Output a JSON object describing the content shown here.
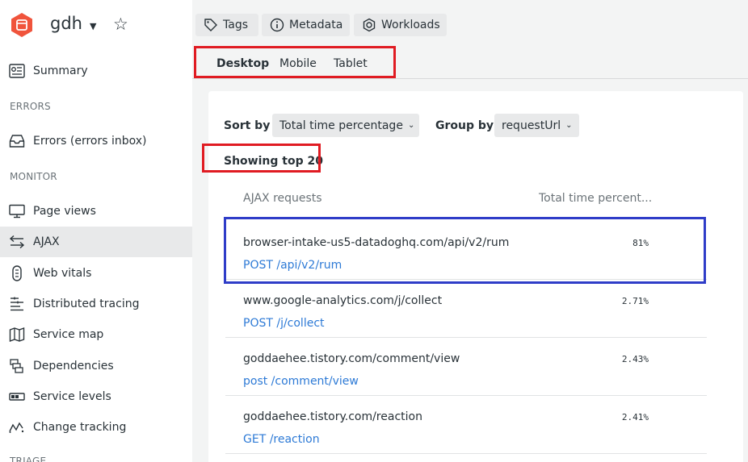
{
  "app": {
    "name": "gdh",
    "icon": "app-hex-icon"
  },
  "top_buttons": [
    {
      "label": "Tags",
      "icon": "tag-icon"
    },
    {
      "label": "Metadata",
      "icon": "info-icon"
    },
    {
      "label": "Workloads",
      "icon": "workloads-icon"
    }
  ],
  "sidebar": {
    "summary": {
      "label": "Summary",
      "icon": "summary-icon"
    },
    "section_errors": "ERRORS",
    "errors_inbox": {
      "label": "Errors (errors inbox)",
      "icon": "inbox-icon"
    },
    "section_monitor": "MONITOR",
    "items": [
      {
        "label": "Page views",
        "icon": "monitor-icon"
      },
      {
        "label": "AJAX",
        "icon": "ajax-arrows-icon",
        "active": true
      },
      {
        "label": "Web vitals",
        "icon": "web-vitals-icon"
      },
      {
        "label": "Distributed tracing",
        "icon": "tracing-icon"
      },
      {
        "label": "Service map",
        "icon": "map-icon"
      },
      {
        "label": "Dependencies",
        "icon": "dependencies-icon"
      },
      {
        "label": "Service levels",
        "icon": "service-levels-icon"
      },
      {
        "label": "Change tracking",
        "icon": "change-tracking-icon"
      }
    ],
    "section_triage": "TRIAGE"
  },
  "tabs": [
    {
      "label": "Desktop",
      "active": true
    },
    {
      "label": "Mobile",
      "active": false
    },
    {
      "label": "Tablet",
      "active": false
    }
  ],
  "controls": {
    "sort_label": "Sort by",
    "sort_value": "Total time percentage",
    "group_label": "Group by",
    "group_value": "requestUrl"
  },
  "showing": "Showing top 20",
  "table": {
    "col_requests": "AJAX requests",
    "col_percent": "Total time percent...",
    "rows": [
      {
        "host": "browser-intake-us5-datadoghq.com/api/v2/rum",
        "path": "POST /api/v2/rum",
        "percent": "81%"
      },
      {
        "host": "www.google-analytics.com/j/collect",
        "path": "POST /j/collect",
        "percent": "2.71%"
      },
      {
        "host": "goddaehee.tistory.com/comment/view",
        "path": "post /comment/view",
        "percent": "2.43%"
      },
      {
        "host": "goddaehee.tistory.com/reaction",
        "path": "GET /reaction",
        "percent": "2.41%"
      }
    ]
  },
  "colors": {
    "accent_red": "#e01b22",
    "highlight_blue": "#2f3dc8",
    "link_blue": "#2d7ad6"
  }
}
